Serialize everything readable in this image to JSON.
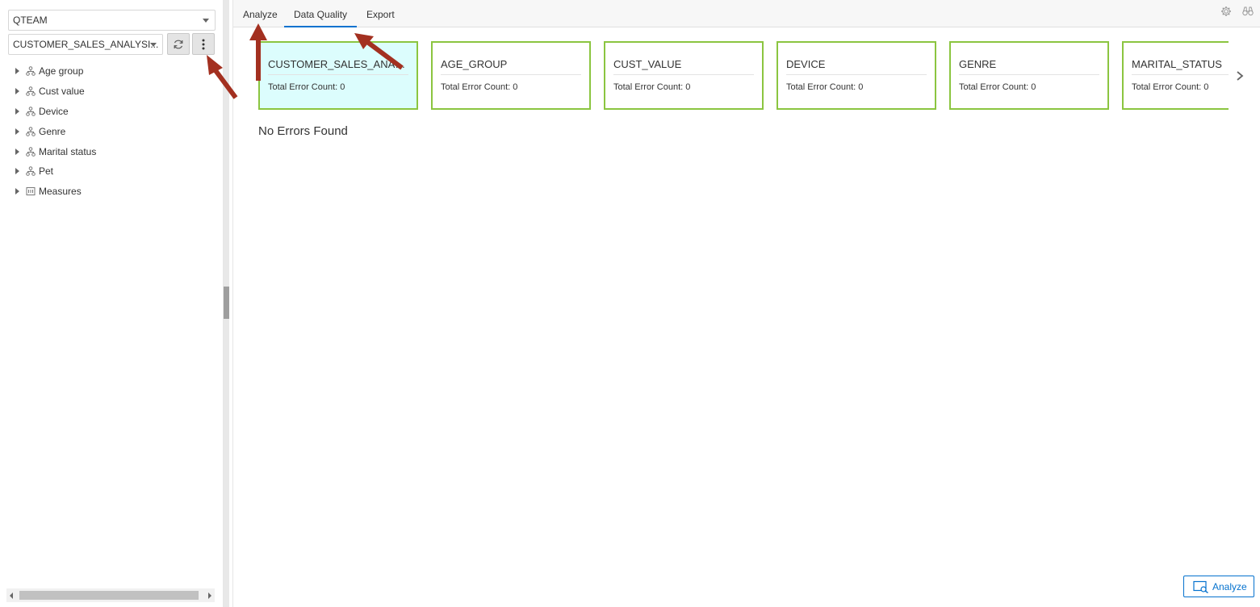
{
  "left": {
    "schema_select": "QTEAM",
    "model_select": "CUSTOMER_SALES_ANALYSI...",
    "tree": [
      {
        "label": "Age group",
        "icon": "hierarchy-icon"
      },
      {
        "label": "Cust value",
        "icon": "hierarchy-icon"
      },
      {
        "label": "Device",
        "icon": "hierarchy-icon"
      },
      {
        "label": "Genre",
        "icon": "hierarchy-icon"
      },
      {
        "label": "Marital status",
        "icon": "hierarchy-icon"
      },
      {
        "label": "Pet",
        "icon": "hierarchy-icon"
      },
      {
        "label": "Measures",
        "icon": "measures-icon"
      }
    ]
  },
  "tabs": [
    {
      "label": "Analyze"
    },
    {
      "label": "Data Quality"
    },
    {
      "label": "Export"
    }
  ],
  "cards": [
    {
      "title": "CUSTOMER_SALES_ANALYSIS",
      "count": "Total Error Count: 0"
    },
    {
      "title": "AGE_GROUP",
      "count": "Total Error Count: 0"
    },
    {
      "title": "CUST_VALUE",
      "count": "Total Error Count: 0"
    },
    {
      "title": "DEVICE",
      "count": "Total Error Count: 0"
    },
    {
      "title": "GENRE",
      "count": "Total Error Count: 0"
    },
    {
      "title": "MARITAL_STATUS",
      "count": "Total Error Count: 0"
    }
  ],
  "main": {
    "no_errors": "No Errors Found",
    "analyze_button": "Analyze"
  },
  "colors": {
    "card_border": "#8bc540",
    "card_selected_bg": "#dcfdfd",
    "accent": "#0572ce",
    "annotation_arrow": "#a33020"
  }
}
